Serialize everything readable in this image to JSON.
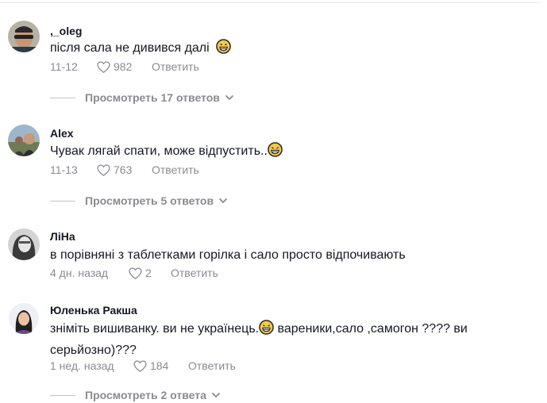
{
  "comments": [
    {
      "username": ",_oleg",
      "text": "після сала не дивився далі",
      "date": "11-12",
      "likes": "982",
      "reply_label": "Ответить",
      "view_replies": "Просмотреть 17 ответов"
    },
    {
      "username": "Alex",
      "text": "Чувак лягай спати, може відпустить..",
      "date": "11-13",
      "likes": "763",
      "reply_label": "Ответить",
      "view_replies": "Просмотреть 5 ответов"
    },
    {
      "username": "ЛіНа",
      "text": "в порівняні з таблетками горілка і сало просто відпочивають",
      "date": "4 дн. назад",
      "likes": "2",
      "reply_label": "Ответить"
    },
    {
      "username": "Юленька Ракша",
      "text_part1": "зніміть вишиванку. ви не українець.",
      "text_part2": " вареники,сало ,самогон ???? ви",
      "text_line2": "серьйозно)???",
      "date": "1 нед. назад",
      "likes": "184",
      "reply_label": "Ответить",
      "view_replies": "Просмотреть 2 ответа"
    }
  ],
  "icons": {
    "heart": "heart-outline-icon",
    "chevron": "chevron-down-icon",
    "emoji": "grinning-face-emoji"
  },
  "colors": {
    "text": "#161823",
    "muted": "#8a8b91",
    "divider": "#e6e6e8"
  }
}
